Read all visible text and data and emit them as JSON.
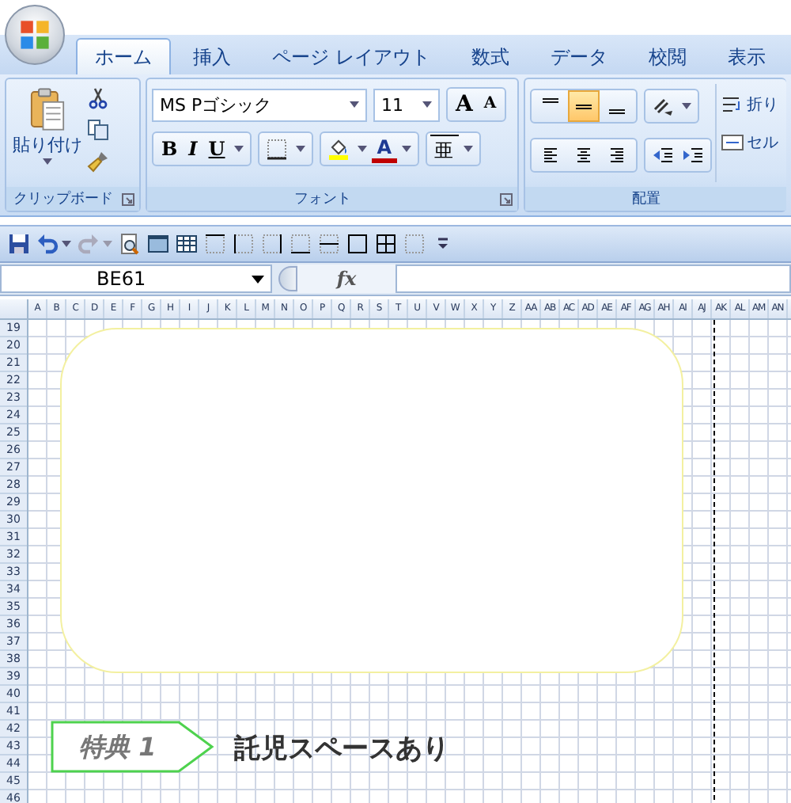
{
  "tabs": [
    {
      "label": "ホーム",
      "selected": true
    },
    {
      "label": "挿入",
      "selected": false
    },
    {
      "label": "ページ レイアウト",
      "selected": false
    },
    {
      "label": "数式",
      "selected": false
    },
    {
      "label": "データ",
      "selected": false
    },
    {
      "label": "校閲",
      "selected": false
    },
    {
      "label": "表示",
      "selected": false
    }
  ],
  "clipboard": {
    "paste_label": "貼り付け",
    "group_label": "クリップボード"
  },
  "font": {
    "name": "MS Pゴシック",
    "size": "11",
    "grow_label": "A",
    "shrink_label": "A",
    "bold_label": "B",
    "italic_label": "I",
    "underline_label": "U",
    "color_label": "A",
    "phonetic_label": "亜",
    "group_label": "フォント"
  },
  "alignment": {
    "vertical": [
      {
        "kind": "top",
        "selected": false
      },
      {
        "kind": "middle",
        "selected": true
      },
      {
        "kind": "bottom",
        "selected": false
      }
    ],
    "horizontal": [
      {
        "kind": "left",
        "selected": false
      },
      {
        "kind": "center",
        "selected": false
      },
      {
        "kind": "right",
        "selected": false
      }
    ],
    "wrap_label": "折り",
    "merge_label": "セル",
    "group_label": "配置"
  },
  "name_box": "BE61",
  "fx_label": "fx",
  "sheet": {
    "columns": [
      "A",
      "B",
      "C",
      "D",
      "E",
      "F",
      "G",
      "H",
      "I",
      "J",
      "K",
      "L",
      "M",
      "N",
      "O",
      "P",
      "Q",
      "R",
      "S",
      "T",
      "U",
      "V",
      "W",
      "X",
      "Y",
      "Z",
      "AA",
      "AB",
      "AC",
      "AD",
      "AE",
      "AF",
      "AG",
      "AH",
      "AI",
      "AJ",
      "AK",
      "AL",
      "AM",
      "AN"
    ],
    "rows": [
      "19",
      "20",
      "21",
      "22",
      "23",
      "24",
      "25",
      "26",
      "27",
      "28",
      "29",
      "30",
      "31",
      "32",
      "33",
      "34",
      "35",
      "36",
      "37",
      "38",
      "39",
      "40",
      "41",
      "42",
      "43",
      "44",
      "45",
      "46"
    ]
  },
  "callout": {
    "tag": "特典 1",
    "text": "託児スペースあり"
  }
}
